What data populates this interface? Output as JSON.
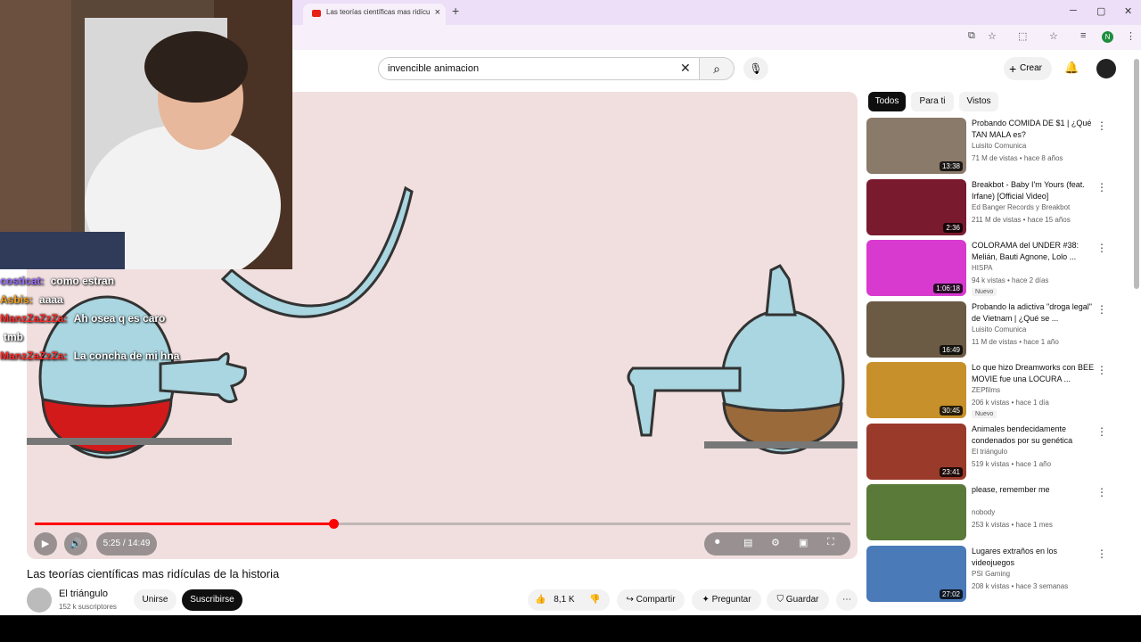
{
  "browser": {
    "tab_title": "Las teorías científicas mas ridícu",
    "tab_close": "×",
    "new_tab": "+",
    "avatar_letter": "N",
    "min": "─",
    "max": "▢",
    "close": "✕"
  },
  "header": {
    "search_value": "invencible animacion",
    "create_label": "Crear"
  },
  "chat": [
    {
      "user": "costicat",
      "user_color": "#9b6bff",
      "text": "como estran"
    },
    {
      "user": "Asbis",
      "user_color": "#f7a21b",
      "text": "aaaa"
    },
    {
      "user": "ManzZaZzZa",
      "user_color": "#ff2b2b",
      "text": "Ah osea q es caro"
    },
    {
      "user": "",
      "user_color": "#ffffff",
      "text": "tmb"
    },
    {
      "user": "ManzZaZzZa",
      "user_color": "#ff2b2b",
      "text": "La concha de mi hna"
    }
  ],
  "player": {
    "time": "5:25 / 14:49",
    "progress": 0.366
  },
  "video": {
    "title": "Las teorías científicas mas ridículas de la historia",
    "channel": "El triángulo",
    "subscribers": "152 k suscriptores",
    "join_label": "Unirse",
    "subscribe_label": "Suscribirse",
    "likes": "8,1 K",
    "share_label": "Compartir",
    "ask_label": "Preguntar",
    "save_label": "Guardar"
  },
  "chips": [
    "Todos",
    "Para ti",
    "Vistos"
  ],
  "recommendations": [
    {
      "title": "Probando COMIDA DE $1 | ¿Qué TAN MALA es?",
      "channel": "Luisito Comunica",
      "meta": "71 M de vistas • hace 8 años",
      "duration": "13:38",
      "badge": "",
      "thumb": "#8a7a6a"
    },
    {
      "title": "Breakbot - Baby I'm Yours (feat. Irfane) [Official Video]",
      "channel": "Ed Banger Records y Breakbot",
      "meta": "211 M de vistas • hace 15 años",
      "duration": "2:36",
      "badge": "",
      "thumb": "#7a1a2e"
    },
    {
      "title": "COLORAMA del UNDER #38: Melián, Bauti Agnone, Lolo ...",
      "channel": "HISPA",
      "meta": "94 k vistas • hace 2 días",
      "duration": "1:06:18",
      "badge": "Nuevo",
      "thumb": "#d83ad0"
    },
    {
      "title": "Probando la adictiva \"droga legal\" de Vietnam | ¿Qué se ...",
      "channel": "Luisito Comunica",
      "meta": "11 M de vistas • hace 1 año",
      "duration": "16:49",
      "badge": "",
      "thumb": "#6b5a44"
    },
    {
      "title": "Lo que hizo Dreamworks con BEE MOVIE fue una LOCURA ...",
      "channel": "ZEPfilms",
      "meta": "206 k vistas • hace 1 día",
      "duration": "30:45",
      "badge": "Nuevo",
      "thumb": "#c8902a"
    },
    {
      "title": "Animales bendecidamente condenados por su genética",
      "channel": "El triángulo",
      "meta": "519 k vistas • hace 1 año",
      "duration": "23:41",
      "badge": "",
      "thumb": "#9a3a2a"
    },
    {
      "title": "please, remember me",
      "channel": "nobody",
      "meta": "253 k vistas • hace 1 mes",
      "duration": "",
      "badge": "",
      "thumb": "#5a7a3a"
    },
    {
      "title": "Lugares extraños en los videojuegos",
      "channel": "PSI Gaming",
      "meta": "208 k vistas • hace 3 semanas",
      "duration": "27:02",
      "badge": "",
      "thumb": "#4a7ab8"
    }
  ]
}
